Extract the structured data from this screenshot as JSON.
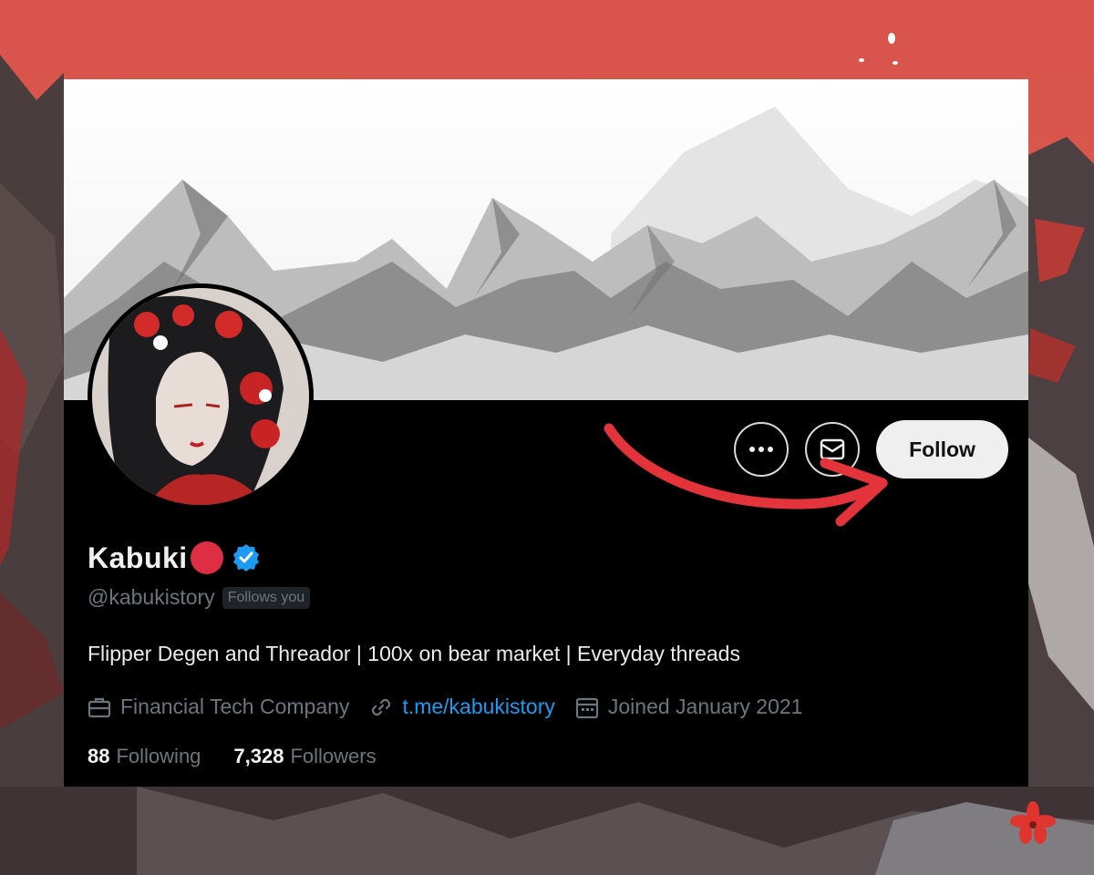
{
  "colors": {
    "background_red": "#d9534a",
    "card_black": "#000000",
    "follow_bg": "#efefef",
    "link_blue": "#1d9bf0",
    "verified_blue": "#1d9bf0",
    "muted_text": "#6e767d",
    "arrow_red": "#e3333b"
  },
  "profile": {
    "display_name": "Kabuki",
    "name_emoji": "red-circle",
    "verified": true,
    "handle": "@kabukistory",
    "follows_you_badge": "Follows you",
    "bio": "Flipper Degen and Threador | 100x on bear market | Everyday threads",
    "category": "Financial Tech Company",
    "link": "t.me/kabukistory",
    "joined": "Joined January 2021",
    "following_count": "88",
    "following_label": "Following",
    "followers_count": "7,328",
    "followers_label": "Followers"
  },
  "actions": {
    "more_icon": "more-horizontal-icon",
    "message_icon": "envelope-icon",
    "follow_label": "Follow"
  },
  "icons": {
    "category": "briefcase-icon",
    "link": "link-icon",
    "joined": "calendar-icon",
    "annotation": "curved-arrow-icon"
  }
}
